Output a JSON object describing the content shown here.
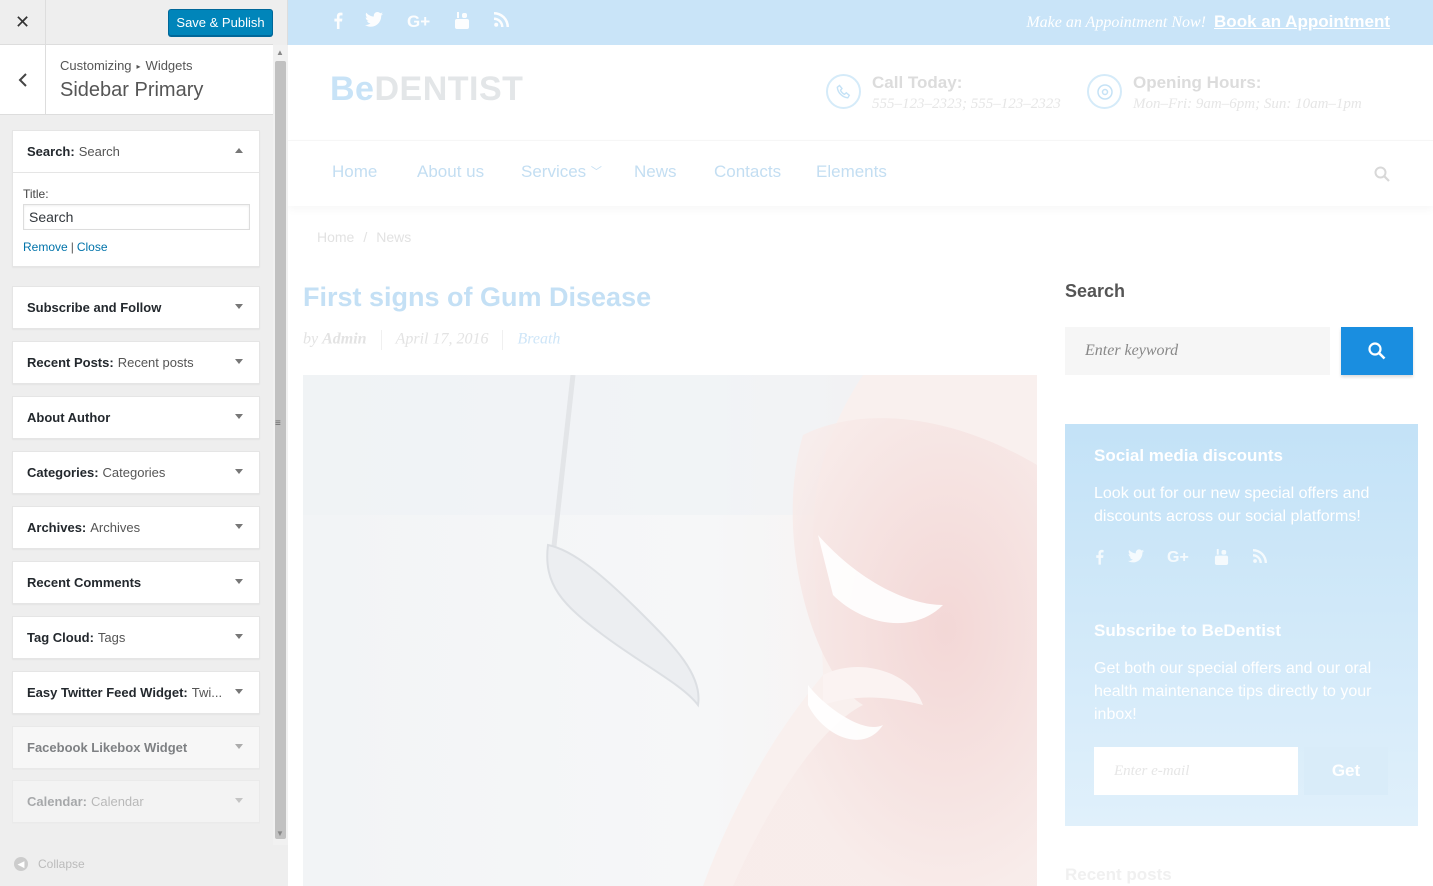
{
  "customizer": {
    "close_icon": "✕",
    "save_label": "Save & Publish",
    "breadcrumb": {
      "part1": "Customizing",
      "separator": "▸",
      "part2": "Widgets"
    },
    "section_title": "Sidebar Primary",
    "collapse_label": "Collapse",
    "widgets": [
      {
        "name": "Search:",
        "sub": "Search",
        "open": true
      },
      {
        "name": "Subscribe and Follow",
        "sub": ""
      },
      {
        "name": "Recent Posts:",
        "sub": "Recent posts"
      },
      {
        "name": "About Author",
        "sub": ""
      },
      {
        "name": "Categories:",
        "sub": "Categories"
      },
      {
        "name": "Archives:",
        "sub": "Archives"
      },
      {
        "name": "Recent Comments",
        "sub": ""
      },
      {
        "name": "Tag Cloud:",
        "sub": "Tags"
      },
      {
        "name": "Easy Twitter Feed Widget:",
        "sub": "Twi..."
      },
      {
        "name": "Facebook Likebox Widget",
        "sub": ""
      },
      {
        "name": "Calendar:",
        "sub": "Calendar"
      }
    ],
    "search_widget": {
      "title_label": "Title:",
      "title_value": "Search",
      "remove_label": "Remove",
      "separator": "|",
      "close_label": "Close"
    }
  },
  "preview": {
    "topbar": {
      "social_icons": [
        "facebook-icon",
        "twitter-icon",
        "google-plus-icon",
        "youtube-icon",
        "rss-icon"
      ],
      "appointment_text": "Make an Appointment Now!",
      "book_link": "Book an Appointment"
    },
    "logo": {
      "part1": "Be",
      "part2": "DENTIST"
    },
    "contacts": {
      "call_heading": "Call Today:",
      "call_value": "555–123–2323; 555–123–2323",
      "hours_heading": "Opening Hours:",
      "hours_value": "Mon–Fri: 9am–6pm; Sun: 10am–1pm"
    },
    "nav": {
      "home": "Home",
      "about": "About us",
      "services": "Services",
      "news": "News",
      "contacts": "Contacts",
      "elements": "Elements"
    },
    "breadcrumb": {
      "home": "Home",
      "separator": "/",
      "current": "News"
    },
    "post": {
      "title": "First signs of Gum Disease",
      "by": "by",
      "author": "Admin",
      "date": "April 17, 2016",
      "category": "Breath"
    },
    "sidebar": {
      "search_title": "Search",
      "search_placeholder": "Enter keyword",
      "promo": {
        "heading1": "Social media discounts",
        "text1": "Look out for our new special offers and discounts across our social platforms!",
        "heading2": "Subscribe to BeDentist",
        "text2": "Get both our special offers and our oral health maintenance tips directly to your inbox!",
        "email_placeholder": "Enter e-mail",
        "get_label": "Get"
      },
      "recent_posts_title": "Recent posts"
    }
  }
}
